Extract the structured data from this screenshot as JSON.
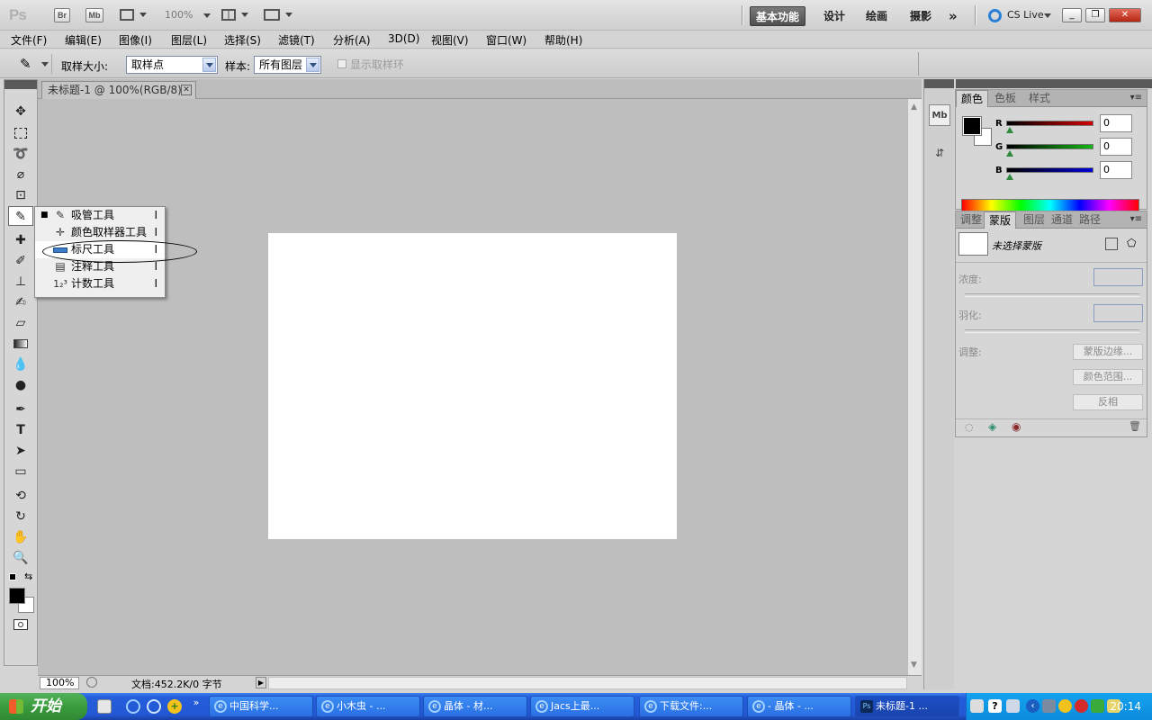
{
  "app": {
    "logo": "Ps",
    "bridge_btn": "Br",
    "minibridge_btn": "Mb",
    "zoom": "100%",
    "workspaces": [
      "基本功能",
      "设计",
      "绘画",
      "摄影"
    ],
    "more": "»",
    "cslive": "CS Live"
  },
  "menu": [
    "文件(F)",
    "编辑(E)",
    "图像(I)",
    "图层(L)",
    "选择(S)",
    "滤镜(T)",
    "分析(A)",
    "3D(D)",
    "视图(V)",
    "窗口(W)",
    "帮助(H)"
  ],
  "options": {
    "sample_size_label": "取样大小:",
    "sample_size_value": "取样点",
    "sample_label": "样本:",
    "sample_value": "所有图层",
    "show_ring_label": "显示取样环"
  },
  "flyout": [
    {
      "label": "吸管工具",
      "key": "I",
      "icon": "eyedropper-icon",
      "bullet": "■"
    },
    {
      "label": "颜色取样器工具",
      "key": "I",
      "icon": "color-sampler-icon",
      "bullet": ""
    },
    {
      "label": "标尺工具",
      "key": "I",
      "icon": "ruler-icon",
      "bullet": ""
    },
    {
      "label": "注释工具",
      "key": "I",
      "icon": "note-icon",
      "bullet": ""
    },
    {
      "label": "计数工具",
      "key": "I",
      "icon": "count-icon",
      "bullet": ""
    }
  ],
  "document": {
    "tab_title": "未标题-1 @ 100%(RGB/8)",
    "status_zoom": "100%",
    "status_doc": "文档:452.2K/0 字节"
  },
  "color_panel": {
    "tabs": [
      "颜色",
      "色板",
      "样式"
    ],
    "r_label": "R",
    "g_label": "G",
    "b_label": "B",
    "r": "0",
    "g": "0",
    "b": "0"
  },
  "mask_panel": {
    "tabs": [
      "调整",
      "蒙版",
      "图层",
      "通道",
      "路径"
    ],
    "title": "未选择蒙版",
    "density_label": "浓度:",
    "feather_label": "羽化:",
    "refine_label": "调整:",
    "mask_edge_btn": "蒙版边缘...",
    "color_range_btn": "颜色范围...",
    "invert_btn": "反相"
  },
  "taskbar": {
    "start": "开始",
    "tasks": [
      "中国科学...",
      "小木虫 - ...",
      "晶体 - 材...",
      "Jacs上最...",
      "下载文件:...",
      "- 晶体 - ...",
      "未标题-1 ..."
    ],
    "clock": "20:14"
  },
  "colors": {
    "active_workspace": "#5a5a5a",
    "r_slider": "#d40000",
    "g_slider": "#14b814",
    "b_slider": "#0000d8",
    "taskbar": "#245edb"
  }
}
